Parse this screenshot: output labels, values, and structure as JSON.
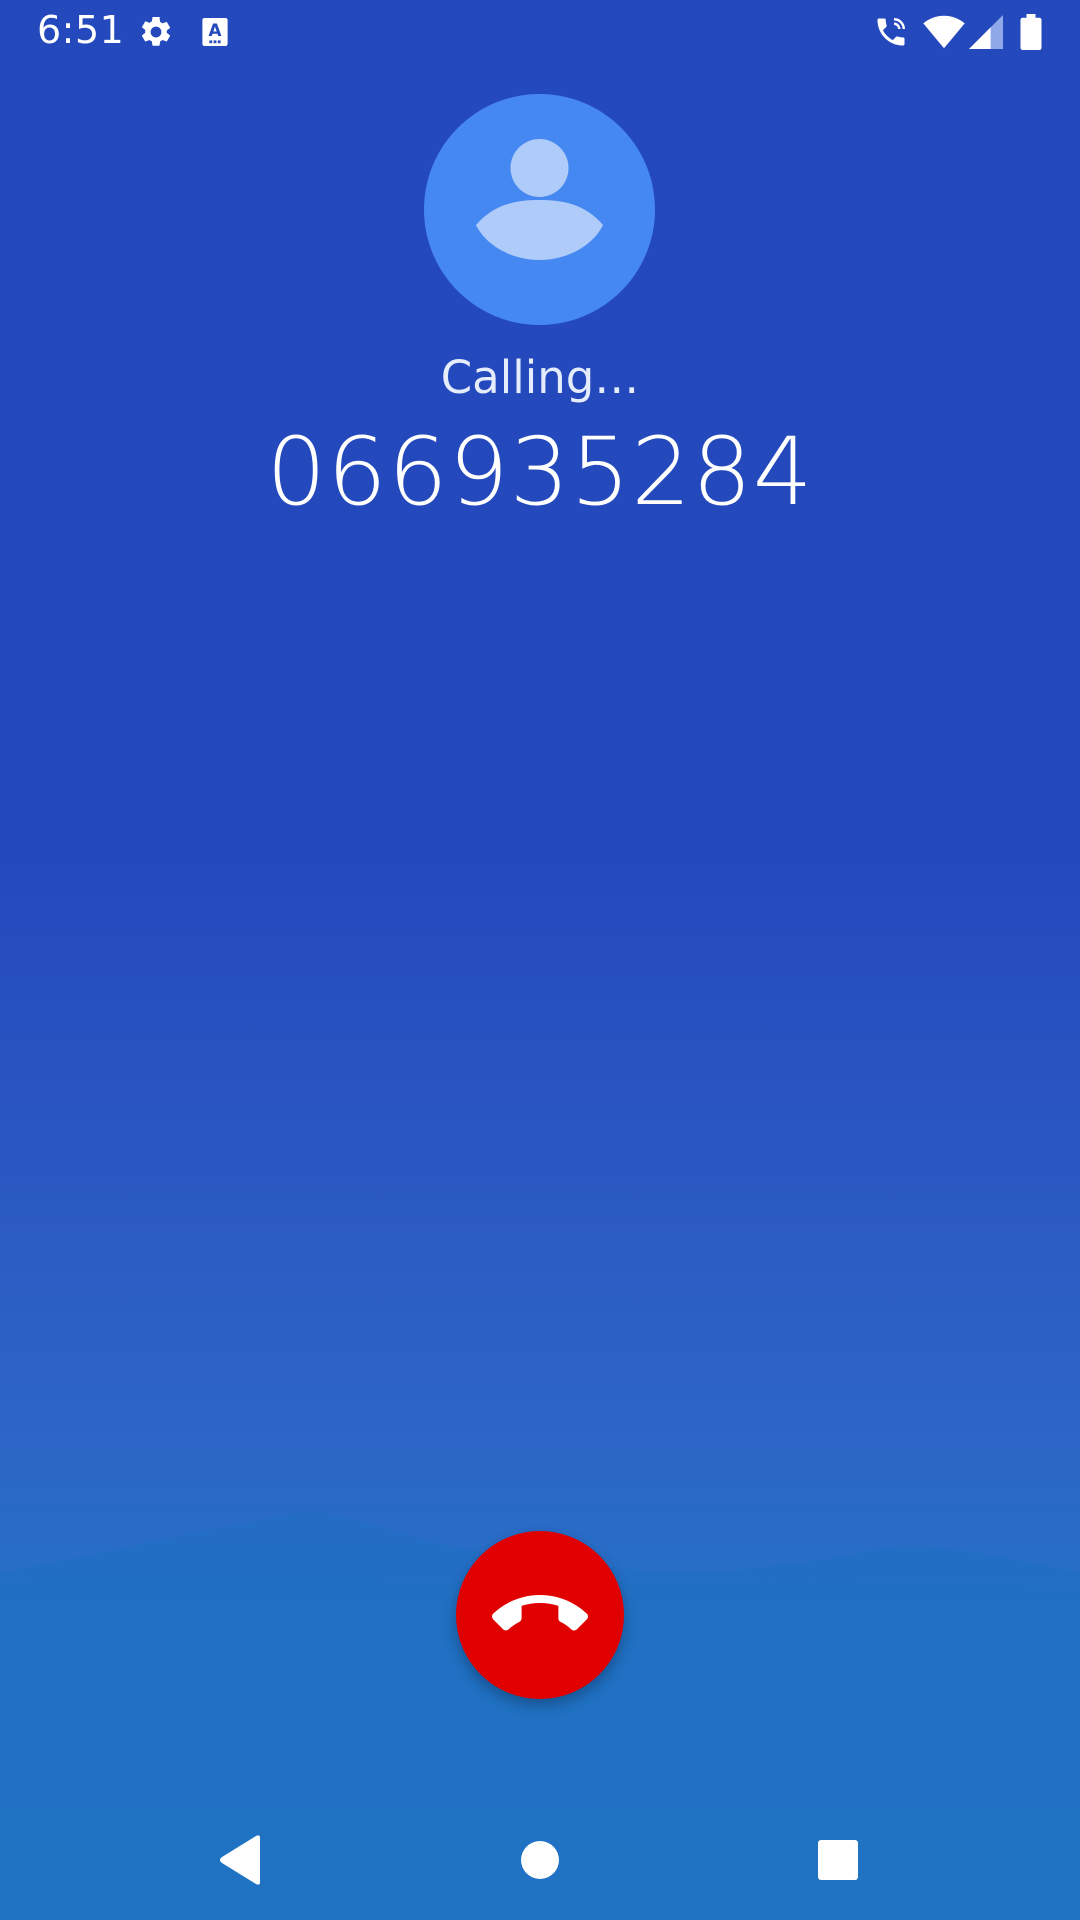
{
  "status_bar": {
    "time": "6:51",
    "left_icons": [
      "gear-icon",
      "text-a-icon"
    ],
    "right_icons": [
      "wifi-calling-icon",
      "wifi-icon",
      "cell-signal-icon",
      "battery-icon"
    ]
  },
  "call": {
    "status": "Calling…",
    "number": "066935284",
    "avatar_icon": "person-icon"
  },
  "actions": {
    "end_call_icon": "call-end-icon"
  },
  "nav": {
    "back_icon": "back-icon",
    "home_icon": "home-icon",
    "recents_icon": "recents-icon"
  },
  "colors": {
    "background_top": "#2449bd",
    "background_bottom": "#237ec7",
    "avatar_bg": "#4688f2",
    "end_call": "#e00000"
  }
}
